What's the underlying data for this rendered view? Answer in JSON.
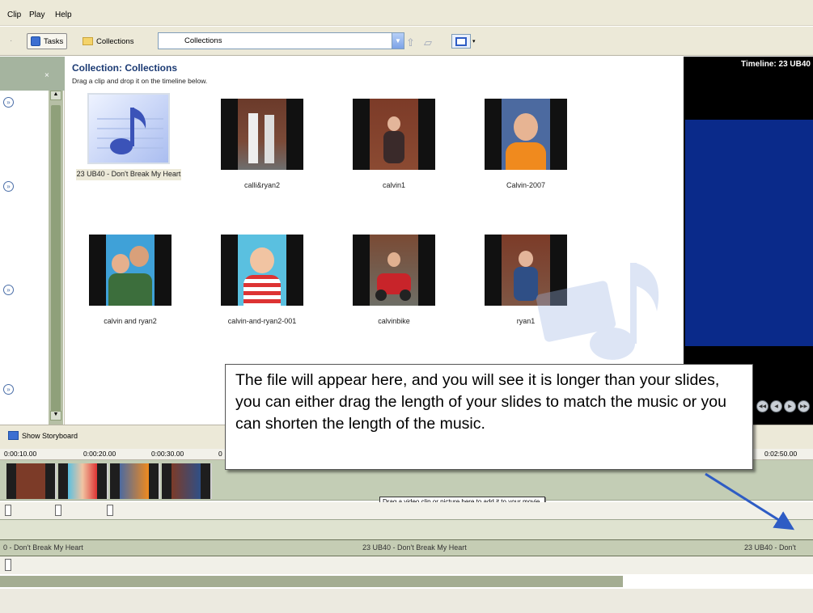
{
  "menu": [
    "Clip",
    "Play",
    "Help"
  ],
  "toolbar": {
    "tasks_label": "Tasks",
    "collections_label": "Collections",
    "collection_select_value": "Collections"
  },
  "collection": {
    "title": "Collection: Collections",
    "hint": "Drag a clip and drop it on the timeline below."
  },
  "clips": [
    {
      "label": "23 UB40 - Don't Break My Heart",
      "type": "audio"
    },
    {
      "label": "calli&ryan2",
      "type": "photo"
    },
    {
      "label": "calvin1",
      "type": "photo"
    },
    {
      "label": "Calvin-2007",
      "type": "photo"
    },
    {
      "label": "calvin and ryan2",
      "type": "photo"
    },
    {
      "label": "calvin-and-ryan2-001",
      "type": "photo"
    },
    {
      "label": "calvinbike",
      "type": "photo"
    },
    {
      "label": "ryan1",
      "type": "photo"
    }
  ],
  "preview": {
    "title": "Timeline: 23 UB40"
  },
  "timeline": {
    "show_storyboard_label": "Show Storyboard",
    "ruler_ticks": [
      "0:00:10.00",
      "0:00:20.00",
      "0:00:30.00",
      "0",
      "0:02:50.00"
    ],
    "drop_hint": "Drag a video clip or picture here to add it to your movie.",
    "audio_labels": [
      "0 - Don't Break My Heart",
      "23 UB40 - Don't Break My Heart",
      "23 UB40 - Don't"
    ]
  },
  "callout_text": "The file will appear here, and you will see it is longer than your slides, you can either drag the length of your slides to match the music or you can shorten the length of the music.",
  "colors": {
    "accent": "#2e5cc4",
    "arrow": "#2e5cc4"
  }
}
